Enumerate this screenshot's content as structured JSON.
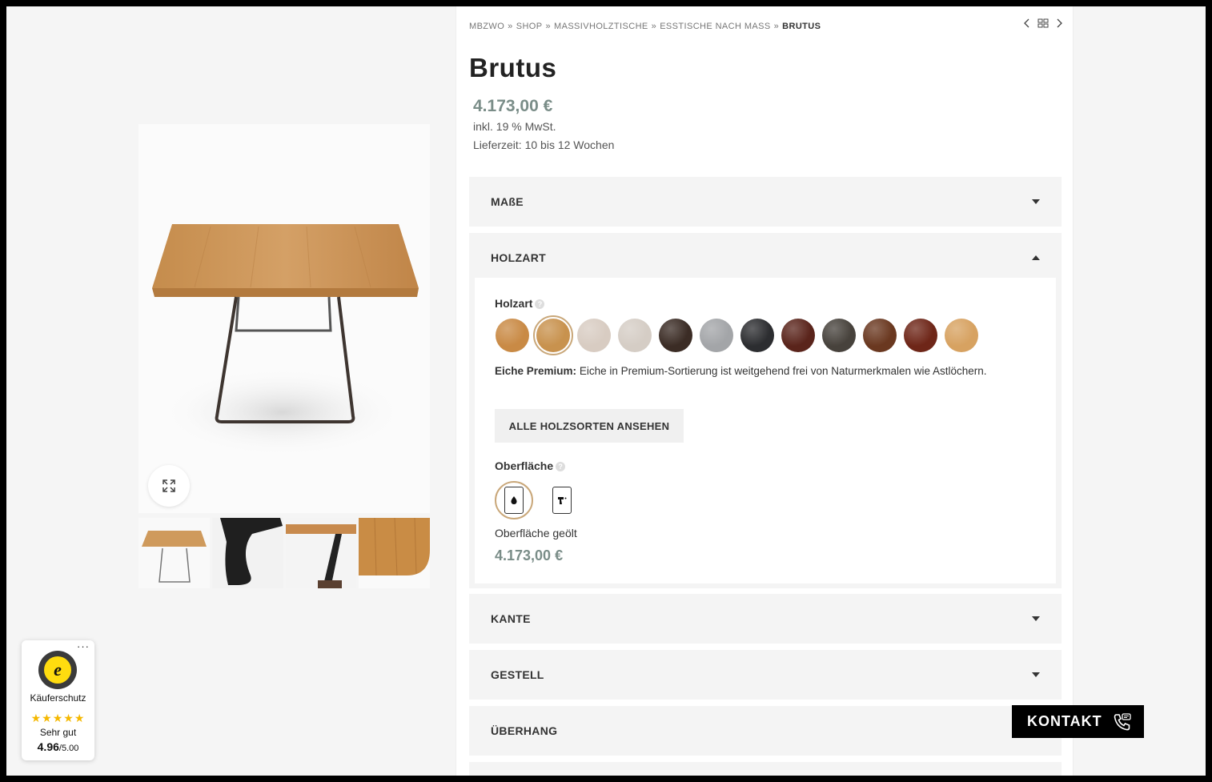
{
  "breadcrumb": {
    "items": [
      "MBZWO",
      "SHOP",
      "MASSIVHOLZTISCHE",
      "ESSTISCHE NACH MASS"
    ],
    "current": "BRUTUS",
    "separator": "»"
  },
  "product": {
    "title": "Brutus",
    "price": "4.173,00 €",
    "tax": "inkl. 19 % MwSt.",
    "delivery": "Lieferzeit: 10 bis 12 Wochen"
  },
  "accordion": {
    "masse": "MAßE",
    "holzart": "HOLZART",
    "kante": "KANTE",
    "gestell": "GESTELL",
    "ueberhang": "ÜBERHANG"
  },
  "holzart": {
    "label": "Holzart",
    "help": "?",
    "swatch_colors": [
      "#c98a45",
      "#c8924e",
      "#d8ccc2",
      "#d5cdc5",
      "#3b2c25",
      "#a3a5a8",
      "#2c2d30",
      "#5a241b",
      "#47423c",
      "#6a3820",
      "#6e2618",
      "#d7a261"
    ],
    "selected_index": 1,
    "description_bold": "Eiche Premium:",
    "description": "Eiche in Premium-Sortierung ist weitgehend frei von Naturmerkmalen wie Astlöchern.",
    "button": "ALLE HOLZSORTEN ANSEHEN"
  },
  "oberflaeche": {
    "label": "Oberfläche",
    "help": "?",
    "selected_text": "Oberfläche geölt",
    "price": "4.173,00 €"
  },
  "trusted_shops": {
    "menu": "···",
    "label": "Käuferschutz",
    "stars": "★★★★★",
    "rating_text": "Sehr gut",
    "score": "4.96",
    "max": "/5.00"
  },
  "kontakt": {
    "label": "KONTAKT"
  },
  "colors": {
    "accent_price": "#7a8d88",
    "selected_ring": "#c9a779",
    "star": "#f5b800"
  }
}
